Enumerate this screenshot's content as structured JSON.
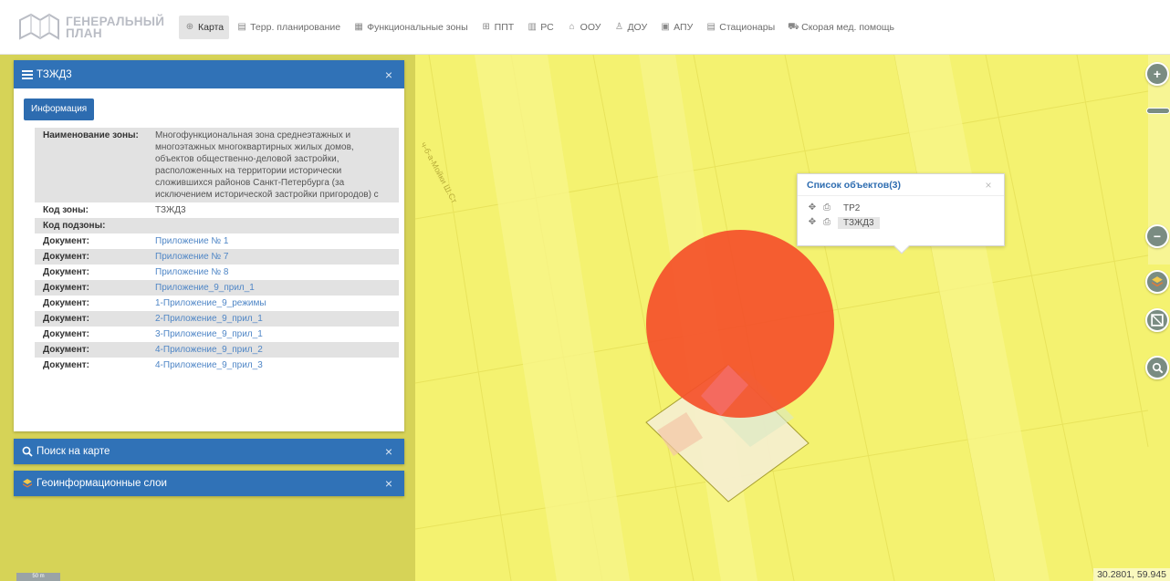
{
  "app": {
    "logo_line1": "ГЕНЕРАЛЬНЫЙ",
    "logo_line2": "ПЛАН"
  },
  "nav": {
    "items": [
      {
        "label": "Карта",
        "icon": "globe-icon",
        "glyph": "⊕",
        "active": true
      },
      {
        "label": "Терр. планирование",
        "icon": "document-icon",
        "glyph": "▤",
        "active": false
      },
      {
        "label": "Функциональные зоны",
        "icon": "zones-icon",
        "glyph": "▦",
        "active": false
      },
      {
        "label": "ППТ",
        "icon": "grid-icon",
        "glyph": "⊞",
        "active": false
      },
      {
        "label": "РС",
        "icon": "list-icon",
        "glyph": "▥",
        "active": false
      },
      {
        "label": "ООУ",
        "icon": "building-icon",
        "glyph": "⌂",
        "active": false
      },
      {
        "label": "ДОУ",
        "icon": "kindergarten-icon",
        "glyph": "♙",
        "active": false
      },
      {
        "label": "АПУ",
        "icon": "board-icon",
        "glyph": "▣",
        "active": false
      },
      {
        "label": "Стационары",
        "icon": "hospital-icon",
        "glyph": "▤",
        "active": false
      },
      {
        "label": "Скорая мед. помощь",
        "icon": "ambulance-icon",
        "glyph": "⛟",
        "active": false
      }
    ]
  },
  "panel_zone": {
    "title": "ТЗЖД3",
    "info_button": "Информация",
    "rows": [
      {
        "key": "Наименование зоны:",
        "value": "Многофункциональная зона среднеэтажных и многоэтажных многоквартирных жилых домов, объектов общественно-деловой застройки, расположенных на территории исторически сложившихся районов Санкт-Петербурга (за исключением исторической застройки пригородов) с",
        "link": false
      },
      {
        "key": "Код зоны:",
        "value": "ТЗЖД3",
        "link": false
      },
      {
        "key": "Код подзоны:",
        "value": "",
        "link": false
      },
      {
        "key": "Документ:",
        "value": "Приложение № 1",
        "link": true
      },
      {
        "key": "Документ:",
        "value": "Приложение № 7",
        "link": true
      },
      {
        "key": "Документ:",
        "value": "Приложение № 8",
        "link": true
      },
      {
        "key": "Документ:",
        "value": "Приложение_9_прил_1",
        "link": true
      },
      {
        "key": "Документ:",
        "value": "1-Приложение_9_режимы",
        "link": true
      },
      {
        "key": "Документ:",
        "value": "2-Приложение_9_прил_1",
        "link": true
      },
      {
        "key": "Документ:",
        "value": "3-Приложение_9_прил_1",
        "link": true
      },
      {
        "key": "Документ:",
        "value": "4-Приложение_9_прил_2",
        "link": true
      },
      {
        "key": "Документ:",
        "value": "4-Приложение_9_прил_3",
        "link": true
      }
    ]
  },
  "panel_search": {
    "title": "Поиск на карте"
  },
  "panel_layers": {
    "title": "Геоинформационные слои"
  },
  "popup": {
    "title": "Список объектов(3)",
    "objects": [
      {
        "name": "ТР2",
        "selected": false
      },
      {
        "name": "ТЗЖД3",
        "selected": true
      }
    ]
  },
  "map": {
    "street_label": "ч-б-а-Мойки Ш.Ст",
    "scale_label": "50 m",
    "coordinates": "30.2801, 59.945",
    "colors": {
      "zone_fill": "#f4f270",
      "marker_fill": "#f4502a",
      "panel_header": "#3072b7",
      "link": "#4f86c6"
    }
  },
  "controls": {
    "zoom_in": "+",
    "zoom_out": "−"
  }
}
